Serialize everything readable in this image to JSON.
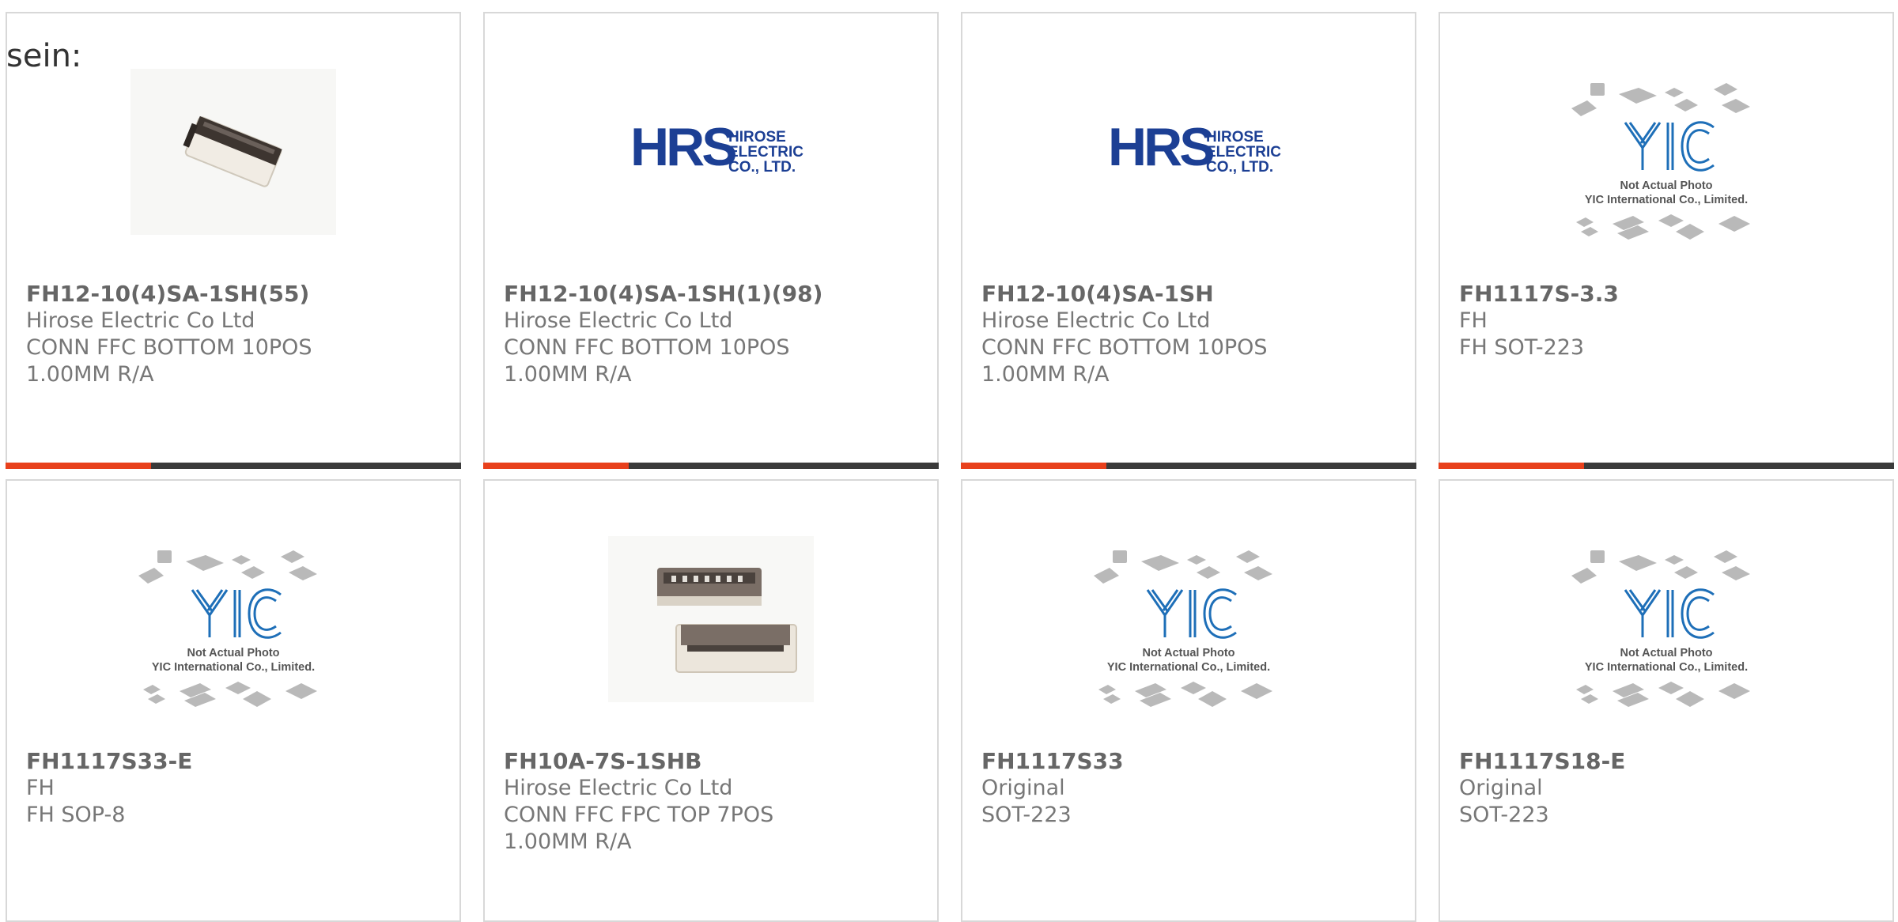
{
  "intro": {
    "text": "sein:"
  },
  "colors": {
    "accent": "#e8401c",
    "bar": "#3a3a3a",
    "logo_blue": "#1c3f94",
    "yic_blue": "#1e6fb8"
  },
  "products": [
    {
      "part": "FH12-10(4)SA-1SH(55)",
      "maker": "Hirose Electric Co Ltd",
      "desc1": "CONN FFC BOTTOM 10POS",
      "desc2": "1.00MM R/A",
      "image": "connector-photo-10pos"
    },
    {
      "part": "FH12-10(4)SA-1SH(1)(98)",
      "maker": "Hirose Electric Co Ltd",
      "desc1": "CONN FFC BOTTOM 10POS",
      "desc2": "1.00MM R/A",
      "image": "hirose-logo"
    },
    {
      "part": "FH12-10(4)SA-1SH",
      "maker": "Hirose Electric Co Ltd",
      "desc1": "CONN FFC BOTTOM 10POS",
      "desc2": "1.00MM R/A",
      "image": "hirose-logo"
    },
    {
      "part": "FH1117S-3.3",
      "maker": "FH",
      "desc1": "FH SOT-223",
      "desc2": "",
      "image": "yic-placeholder"
    },
    {
      "part": "FH1117S33-E",
      "maker": "FH",
      "desc1": "FH SOP-8",
      "desc2": "",
      "image": "yic-placeholder"
    },
    {
      "part": "FH10A-7S-1SHB",
      "maker": "Hirose Electric Co Ltd",
      "desc1": "CONN FFC FPC TOP 7POS",
      "desc2": "1.00MM R/A",
      "image": "connector-photo-7pos"
    },
    {
      "part": "FH1117S33",
      "maker": "Original",
      "desc1": "SOT-223",
      "desc2": "",
      "image": "yic-placeholder"
    },
    {
      "part": "FH1117S18-E",
      "maker": "Original",
      "desc1": "SOT-223",
      "desc2": "",
      "image": "yic-placeholder"
    }
  ],
  "logos": {
    "hirose_mark": "HRS",
    "hirose_name": [
      "HIROSE",
      "ELECTRIC",
      "CO., LTD."
    ],
    "yic_mark": "YIC",
    "yic_caption1": "Not Actual Photo",
    "yic_caption2": "YIC International Co., Limited."
  }
}
